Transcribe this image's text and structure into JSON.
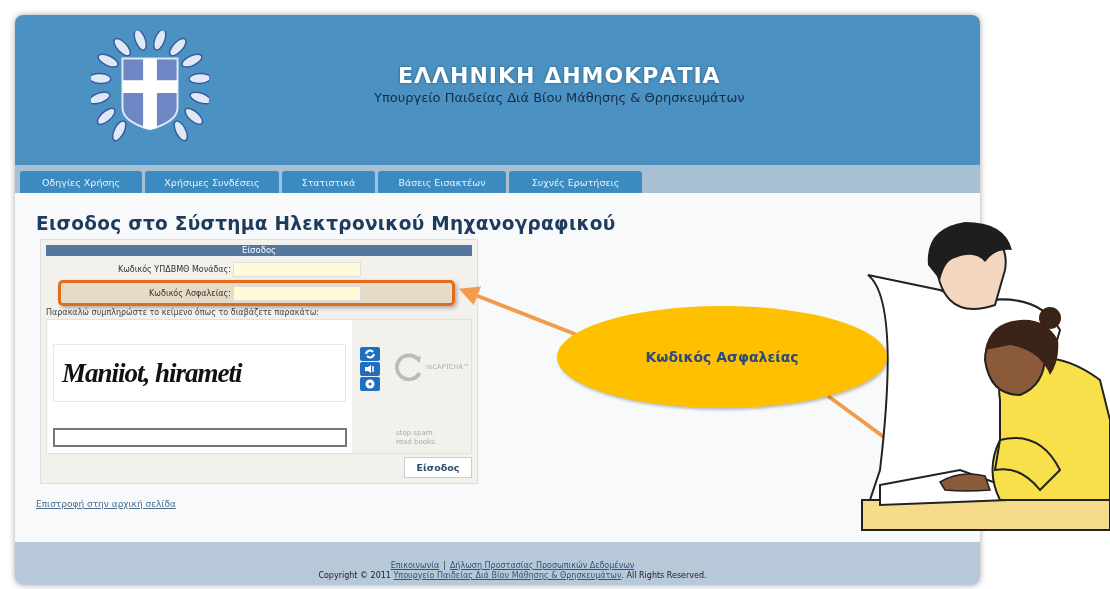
{
  "header": {
    "title": "ΕΛΛΗΝΙΚΗ ΔΗΜΟΚΡΑΤΙΑ",
    "subtitle": "Υπουργείο Παιδείας Διά Βίου Μάθησης & Θρησκευμάτων"
  },
  "tabs": [
    {
      "label": "Οδηγίες Χρήσης",
      "selected": false
    },
    {
      "label": "Χρήσιμες Συνδέσεις",
      "selected": false
    },
    {
      "label": "Στατιστικά",
      "selected": false
    },
    {
      "label": "Βάσεις Εισακτέων",
      "selected": false
    },
    {
      "label": "Συχνές Ερωτήσεις",
      "selected": false
    }
  ],
  "heading": "Εισοδος στο Σύστημα Ηλεκτρονικού Μηχανογραφικού",
  "login_form": {
    "title": "Είσοδος",
    "fields": [
      {
        "label": "Κωδικός ΥΠΔΒΜΘ Μονάδας:",
        "highlighted": false
      },
      {
        "label": "Κωδικός Ασφαλείας:",
        "highlighted": true
      }
    ],
    "captcha": {
      "prompt": "Παρακαλώ συμπληρώστε το κείμενο όπως το διαβάζετε παρακάτω:",
      "challenge": "Maniiot, hirameti",
      "logo": "reCAPTCHA™",
      "tagline": [
        "stop spam.",
        "read books."
      ]
    },
    "submit": "Είσοδος"
  },
  "back_link": "Επιστροφή στην αρχική σελίδα",
  "footer": {
    "links": [
      "Επικοινωνία",
      "Δήλωση Προστασίας Προσωπικών Δεδομένων"
    ],
    "separator": "|",
    "copyright_prefix": "Copyright © 2011",
    "copyright_link": "Υπουργείο Παιδείας Διά Βίου Μάθησης & Θρησκευμάτων",
    "copyright_suffix": ". All Rights Reserved."
  },
  "callout": {
    "text": "Κωδικός Ασφαλείας"
  }
}
